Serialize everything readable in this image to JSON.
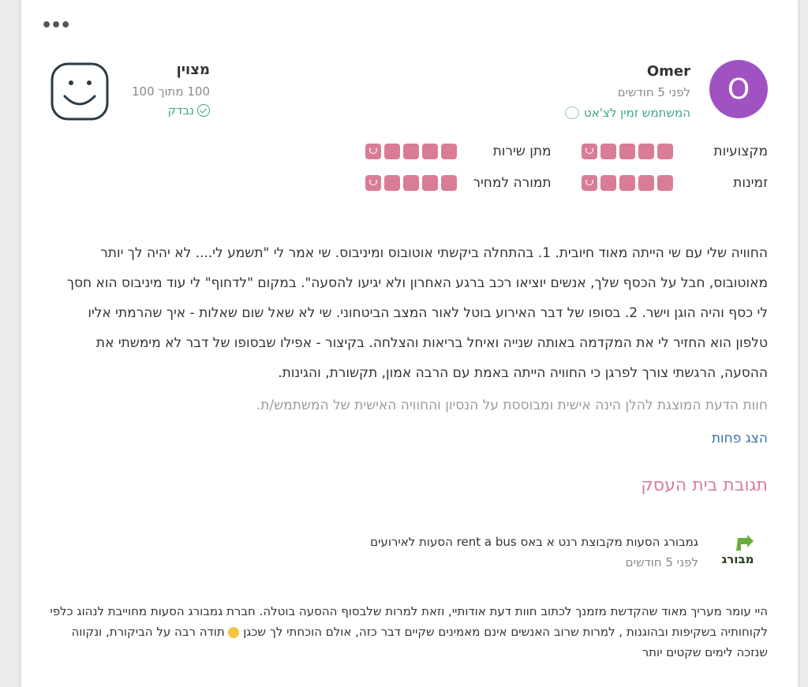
{
  "header": {
    "more_icon": "more-dots-icon"
  },
  "user": {
    "avatar_letter": "O",
    "avatar_color": "#a052c3",
    "name": "Omer",
    "time": "לפני 5 חודשים",
    "badge": "המשתמש זמין לצ'אט"
  },
  "score": {
    "label": "מצוין",
    "value": "100 מתוך 100",
    "verified": "נבדק"
  },
  "ratings": [
    {
      "label": "מקצועיות",
      "score": 5
    },
    {
      "label": "מתן שירות",
      "score": 5
    },
    {
      "label": "זמינות",
      "score": 5
    },
    {
      "label": "תמורה למחיר",
      "score": 5
    }
  ],
  "review": {
    "text": "החוויה שלי עם שי הייתה מאוד חיובית. 1. בהתחלה ביקשתי אוטובוס ומיניבוס. שי אמר לי \"תשמע לי.... לא יהיה לך יותר מאוטובוס, חבל על הכסף שלך, אנשים יוציאו רכב ברגע האחרון ולא יגיעו להסעה\". במקום \"לדחוף\" לי עוד מיניבוס הוא חסך לי כסף והיה הוגן וישר. 2. בסופו של דבר האירוע בוטל לאור המצב הביטחוני. שי לא שאל שום שאלות - איך שהרמתי אליו טלפון הוא החזיר לי את המקדמה באותה שנייה ואיחל בריאות והצלחה. בקיצור - אפילו שבסופו של דבר לא מימשתי את ההסעה, הרגשתי צורך לפרגן כי החוויה הייתה באמת עם הרבה אמון, תקשורת, והגינות.",
    "disclaimer": "חוות הדעת המוצגת להלן הינה אישית ומבוססת על הנסיון והחוויה האישית של המשתמש/ת.",
    "show_less": "הצג פחות"
  },
  "business": {
    "section_title": "תגובת בית העסק",
    "logo_text": "מבורג",
    "logo_color": "#6cae3c",
    "name": "גמבורג הסעות מקבוצת רנט א באס rent a bus הסעות לאירועים",
    "time": "לפני 5 חודשים",
    "reply_part1": "היי עומר מעריך מאוד שהקדשת מזמנך לכתוב חוות דעת אודותיי, וזאת למרות שלבסוף ההסעה בוטלה. חברת גמבורג הסעות מחוייבת לנהוג כלפי לקוחותיה בשקיפות ובהוגנות , למרות שרוב האנשים אינם מאמינים שקיים דבר כזה, אולם הוכחתי לך שכגן ",
    "reply_part2": " תודה רבה על הביקורת, ונקווה שנזכה לימים שקטים יותר"
  }
}
